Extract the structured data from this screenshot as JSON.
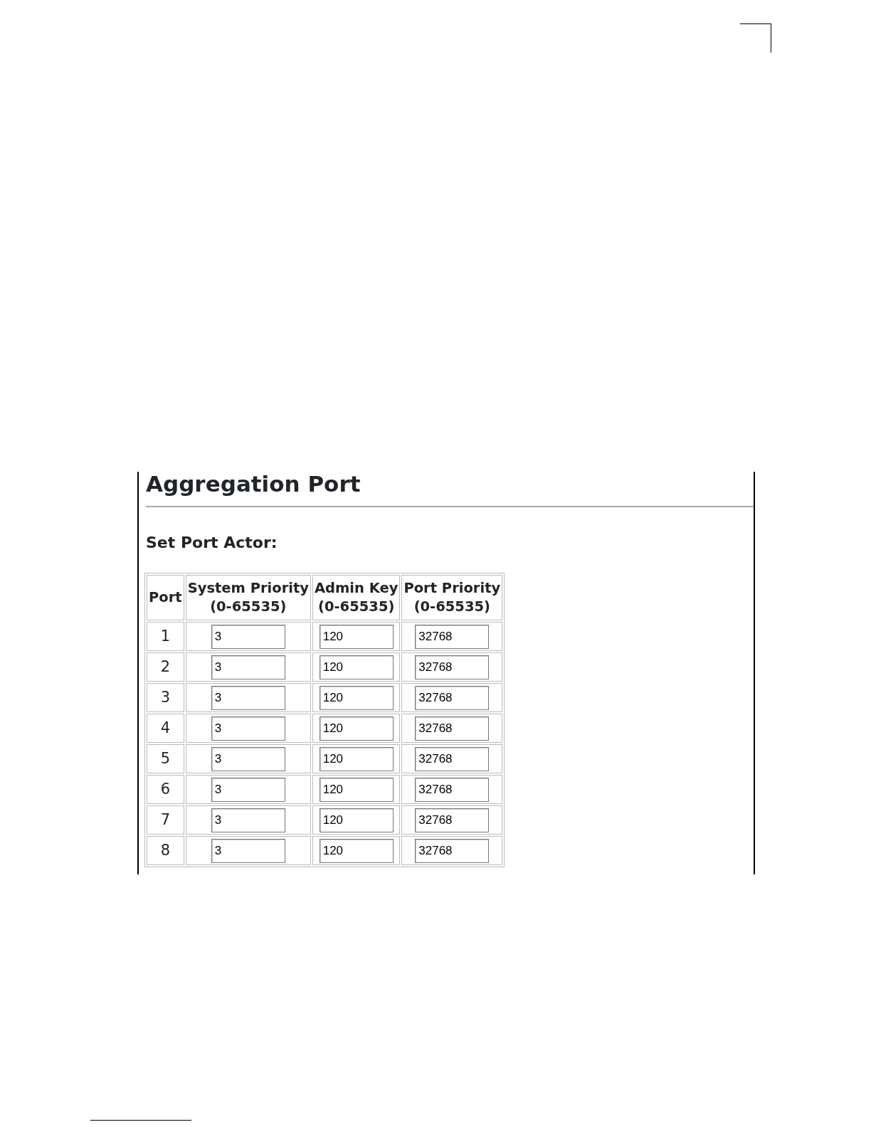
{
  "page": {
    "title": "Aggregation Port",
    "section": "Set Port Actor:"
  },
  "table": {
    "columns": [
      {
        "label": "Port"
      },
      {
        "label": "System Priority",
        "range": "(0-65535)"
      },
      {
        "label": "Admin Key",
        "range": "(0-65535)"
      },
      {
        "label": "Port Priority",
        "range": "(0-65535)"
      }
    ],
    "rows": [
      {
        "port": "1",
        "system_priority": "3",
        "admin_key": "120",
        "port_priority": "32768"
      },
      {
        "port": "2",
        "system_priority": "3",
        "admin_key": "120",
        "port_priority": "32768"
      },
      {
        "port": "3",
        "system_priority": "3",
        "admin_key": "120",
        "port_priority": "32768"
      },
      {
        "port": "4",
        "system_priority": "3",
        "admin_key": "120",
        "port_priority": "32768"
      },
      {
        "port": "5",
        "system_priority": "3",
        "admin_key": "120",
        "port_priority": "32768"
      },
      {
        "port": "6",
        "system_priority": "3",
        "admin_key": "120",
        "port_priority": "32768"
      },
      {
        "port": "7",
        "system_priority": "3",
        "admin_key": "120",
        "port_priority": "32768"
      },
      {
        "port": "8",
        "system_priority": "3",
        "admin_key": "120",
        "port_priority": "32768"
      }
    ]
  }
}
